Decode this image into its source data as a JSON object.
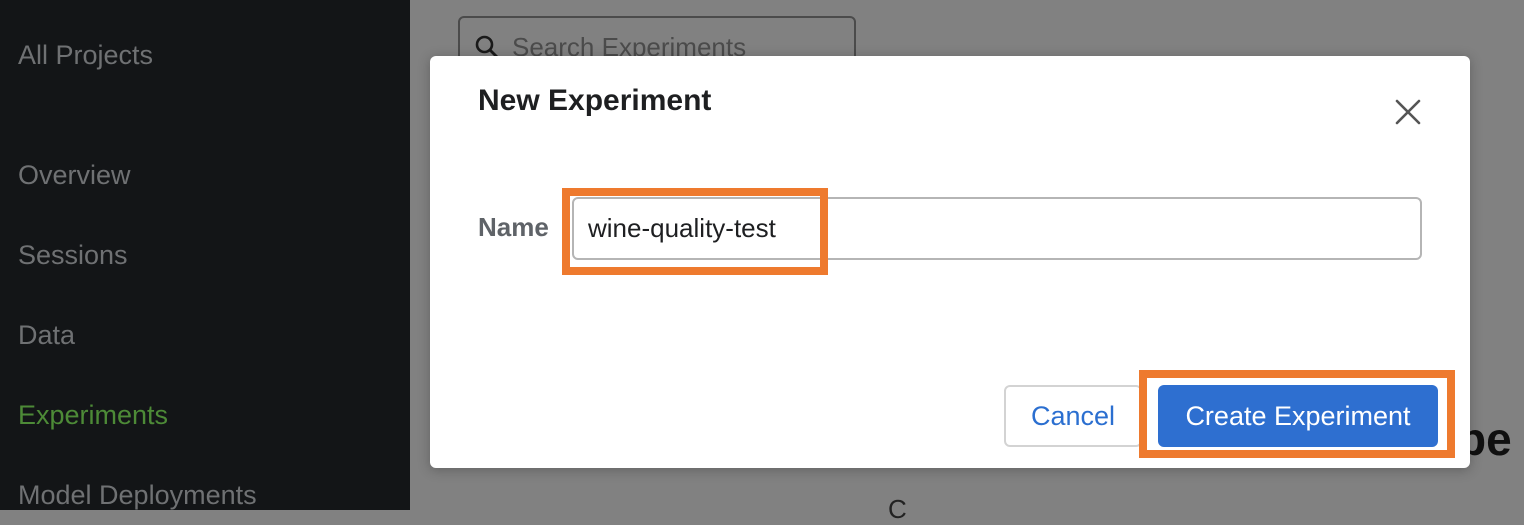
{
  "sidebar": {
    "items": [
      {
        "label": "All Projects"
      },
      {
        "label": "Overview"
      },
      {
        "label": "Sessions"
      },
      {
        "label": "Data"
      },
      {
        "label": "Experiments"
      },
      {
        "label": "Model Deployments"
      }
    ],
    "active_index": 4,
    "active_color": "#4d8a37"
  },
  "main": {
    "search": {
      "placeholder": "Search Experiments",
      "icon": "search-icon"
    },
    "heading_fragment": "pe",
    "text_fragment": "C"
  },
  "modal": {
    "title": "New Experiment",
    "close_icon": "close-icon",
    "name_label": "Name",
    "name_value": "wine-quality-test",
    "cancel_label": "Cancel",
    "create_label": "Create Experiment"
  },
  "colors": {
    "primary": "#2e6fd0",
    "highlight": "#ee7a2e"
  }
}
